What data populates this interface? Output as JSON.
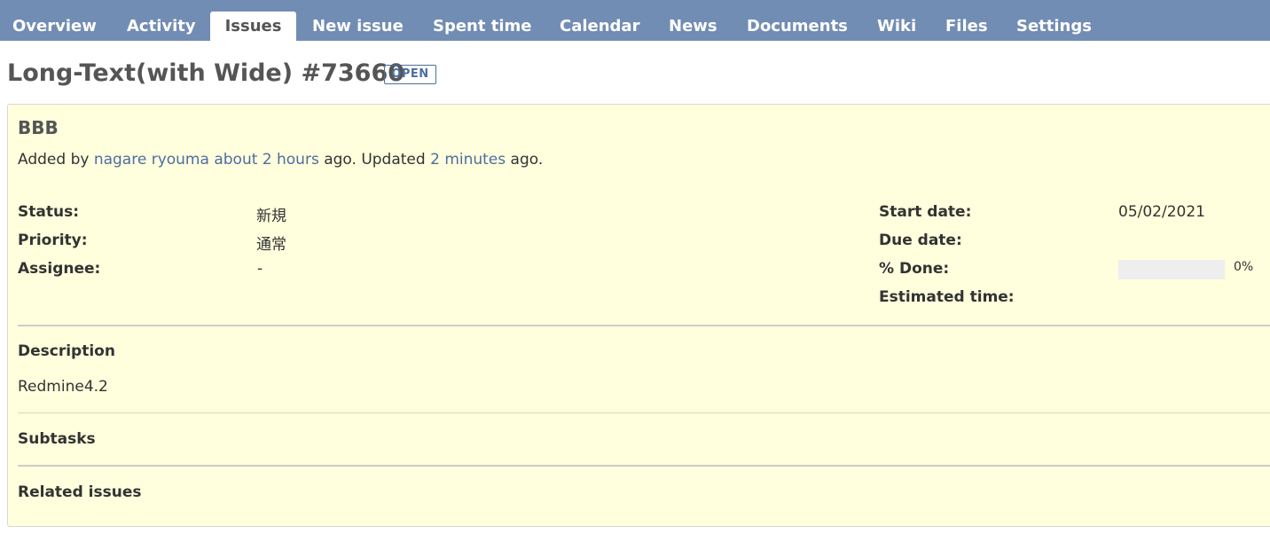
{
  "tabs": [
    {
      "label": "Overview"
    },
    {
      "label": "Activity"
    },
    {
      "label": "Issues",
      "selected": true
    },
    {
      "label": "New issue"
    },
    {
      "label": "Spent time"
    },
    {
      "label": "Calendar"
    },
    {
      "label": "News"
    },
    {
      "label": "Documents"
    },
    {
      "label": "Wiki"
    },
    {
      "label": "Files"
    },
    {
      "label": "Settings"
    }
  ],
  "issue": {
    "title": "Long-Text(with Wide) #73660",
    "status_badge": "OPEN",
    "subject": "BBB",
    "author": {
      "prefix": "Added by ",
      "name": "nagare ryouma",
      "created_ago": "about 2 hours",
      "ago_updated": " ago. Updated ",
      "updated_ago": "2 minutes",
      "suffix": " ago."
    },
    "attributes_left": [
      {
        "label": "Status:",
        "value": "新規"
      },
      {
        "label": "Priority:",
        "value": "通常"
      },
      {
        "label": "Assignee:",
        "value": "-"
      }
    ],
    "attributes_right": [
      {
        "label": "Start date:",
        "value": "05/02/2021"
      },
      {
        "label": "Due date:",
        "value": ""
      },
      {
        "label": "% Done:",
        "value": "0%",
        "progress": 0
      },
      {
        "label": "Estimated time:",
        "value": ""
      }
    ],
    "description": {
      "heading": "Description",
      "text": "Redmine4.2"
    },
    "subtasks": {
      "heading": "Subtasks"
    },
    "related": {
      "heading": "Related issues"
    }
  },
  "colors": {
    "header_bg": "#728db4",
    "link": "#4d6da1",
    "issue_bg": "#ffffdd"
  }
}
